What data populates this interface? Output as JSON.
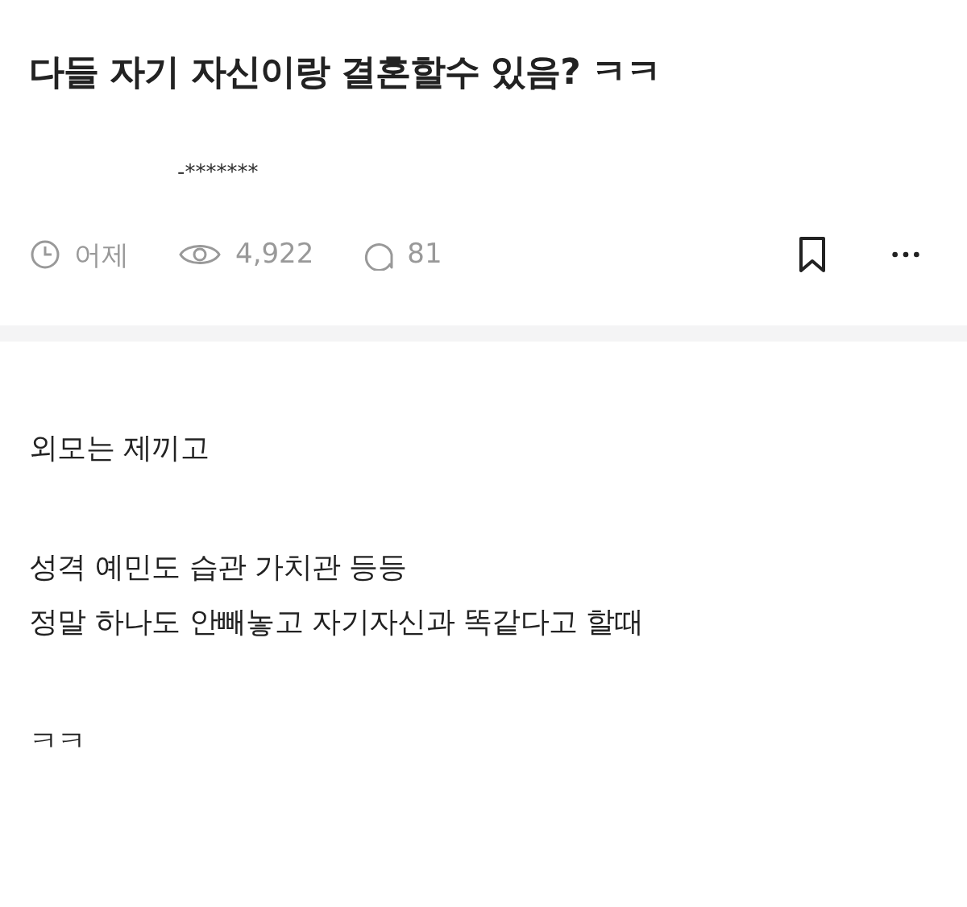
{
  "post": {
    "title": "다들 자기 자신이랑 결혼할수 있음? ㅋㅋ",
    "author": "-*******",
    "time": "어제",
    "views": "4,922",
    "comments": "81"
  },
  "body": [
    [
      "외모는 제끼고"
    ],
    [
      "성격 예민도 습관 가치관 등등",
      "정말 하나도 안빼놓고 자기자신과 똑같다고 할때"
    ],
    [
      "ㅋㅋ"
    ]
  ]
}
